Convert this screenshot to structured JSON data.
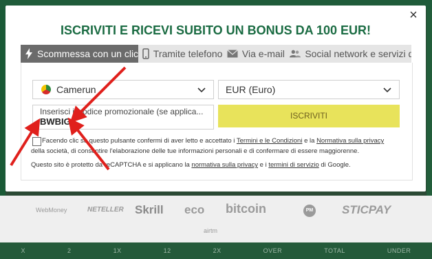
{
  "modal": {
    "title": "ISCRIVITI E RICEVI SUBITO UN BONUS DA 100 EUR!",
    "close_label": "×"
  },
  "tabs": [
    {
      "label": "Scommessa con un clic",
      "icon": "lightning-icon"
    },
    {
      "label": "Tramite telefono",
      "icon": "phone-icon"
    },
    {
      "label": "Via e-mail",
      "icon": "envelope-icon"
    },
    {
      "label": "Social network e servizi d...",
      "icon": "users-icon"
    }
  ],
  "form": {
    "country_value": "Camerun",
    "currency_value": "EUR (Euro)",
    "promo_label": "Inserisci il codice promozionale (se applica...",
    "promo_value": "BWBIG",
    "submit_label": "ISCRIVITI",
    "consent_pre": "Facendo clic su questo pulsante confermi di aver letto e accettato i ",
    "terms_link": "Termini e le Condizioni",
    "consent_mid": " e la ",
    "privacy_link": "Normativa sulla privacy",
    "consent_post": "della società, di consentire l'elaborazione delle tue informazioni personali e di confermare di essere maggiorenne.",
    "recaptcha_pre": "Questo sito è protetto da reCAPTCHA e si applicano la ",
    "recaptcha_privacy_link": "normativa sulla privacy",
    "recaptcha_mid": " e i ",
    "recaptcha_terms_link": "termini di servizio",
    "recaptcha_post": " di Google."
  },
  "payment_logos": [
    "WebMoney",
    "NETELLER",
    "Skrill",
    "eco",
    "bitcoin",
    "PM",
    "STICPAY",
    "airtm"
  ],
  "background_labels": [
    "X",
    "2",
    "1X",
    "12",
    "2X",
    "OVER",
    "TOTAL",
    "UNDER"
  ],
  "colors": {
    "title_green": "#1a6b42",
    "submit_yellow": "#e8e35b",
    "active_tab": "#6b6b6b",
    "arrow_red": "#e0201c"
  }
}
